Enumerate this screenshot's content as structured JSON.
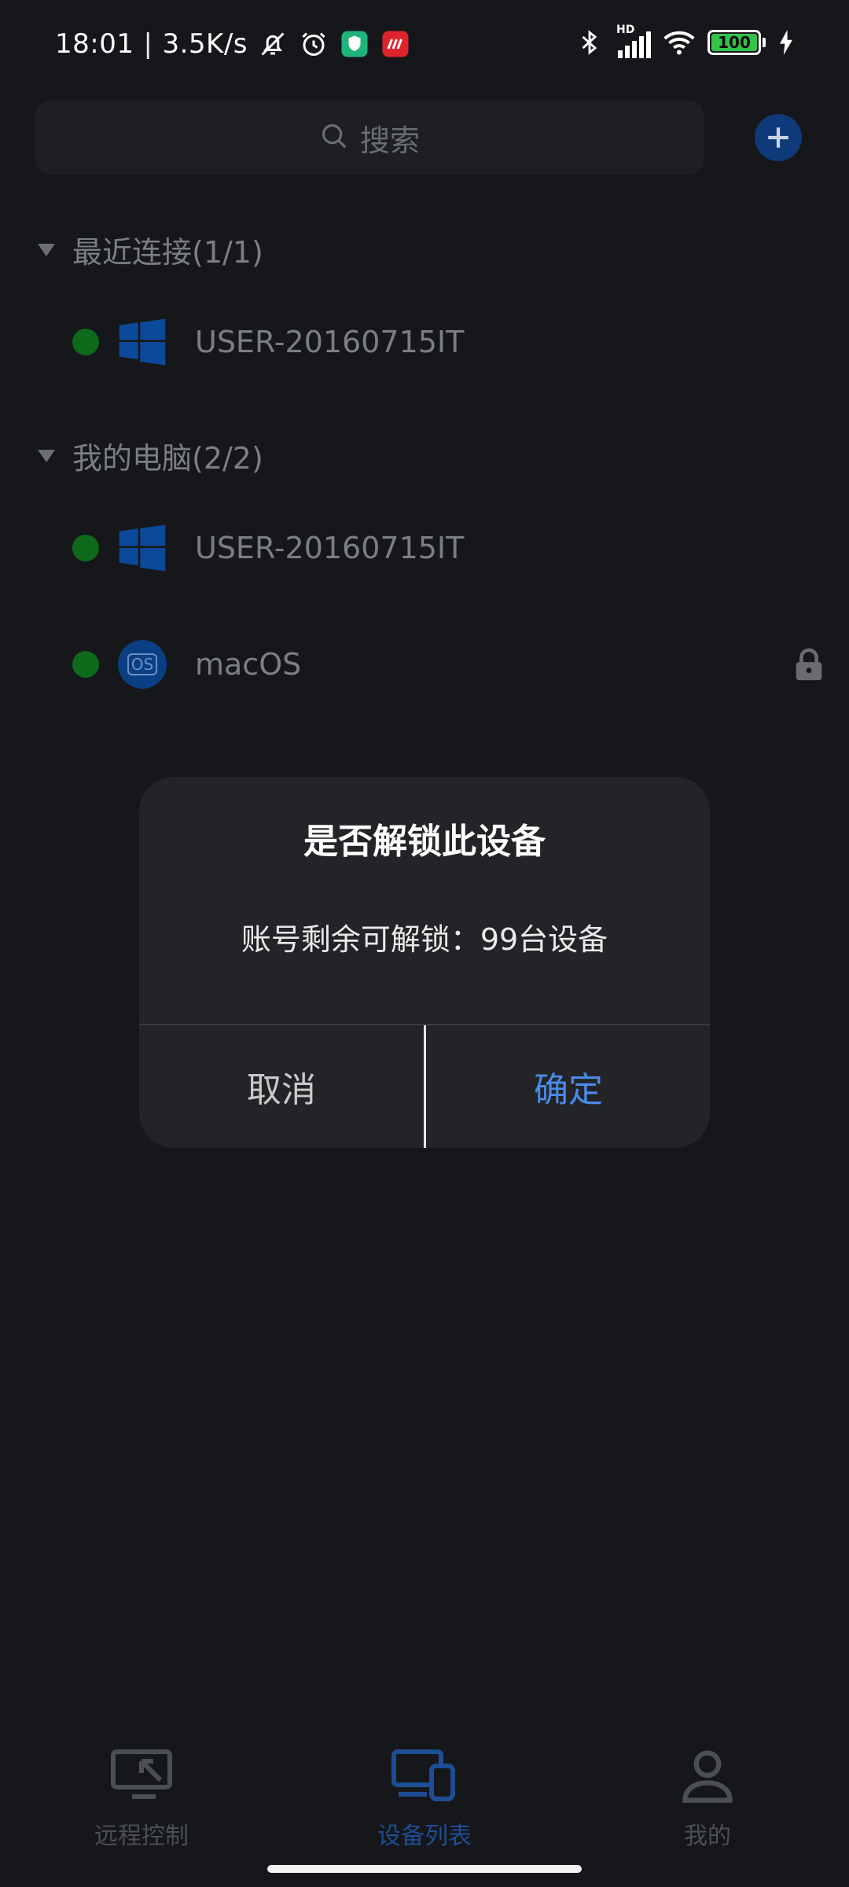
{
  "status_bar": {
    "time": "18:01",
    "network_speed": "3.5K/s",
    "signal_label": "HD",
    "battery": "100",
    "icons": [
      "bell-off-icon",
      "alarm-icon",
      "shield-app-icon",
      "red-app-icon",
      "bluetooth-icon",
      "signal-icon",
      "wifi-icon",
      "battery-icon",
      "charging-icon"
    ]
  },
  "search": {
    "placeholder": "搜索"
  },
  "sections": {
    "recent": {
      "title": "最近连接(1/1)",
      "devices": [
        {
          "name": "USER-20160715IT",
          "os": "windows-icon",
          "status": "online"
        }
      ]
    },
    "my_computers": {
      "title": "我的电脑(2/2)",
      "devices": [
        {
          "name": "USER-20160715IT",
          "os": "windows-icon",
          "status": "online"
        },
        {
          "name": "macOS",
          "os": "macos-icon",
          "os_badge": "OS",
          "status": "online",
          "locked": true
        }
      ]
    }
  },
  "dialog": {
    "title": "是否解锁此设备",
    "message": "账号剩余可解锁：99台设备",
    "cancel_label": "取消",
    "confirm_label": "确定"
  },
  "bottom_nav": {
    "items": [
      {
        "label": "远程控制",
        "icon": "remote-control-icon",
        "active": false
      },
      {
        "label": "设备列表",
        "icon": "device-list-icon",
        "active": true
      },
      {
        "label": "我的",
        "icon": "profile-icon",
        "active": false
      }
    ]
  },
  "colors": {
    "background": "#16171a",
    "accent": "#4a8ae8",
    "online": "#0d6a1a",
    "windows_blue": "#0b4a9a"
  }
}
